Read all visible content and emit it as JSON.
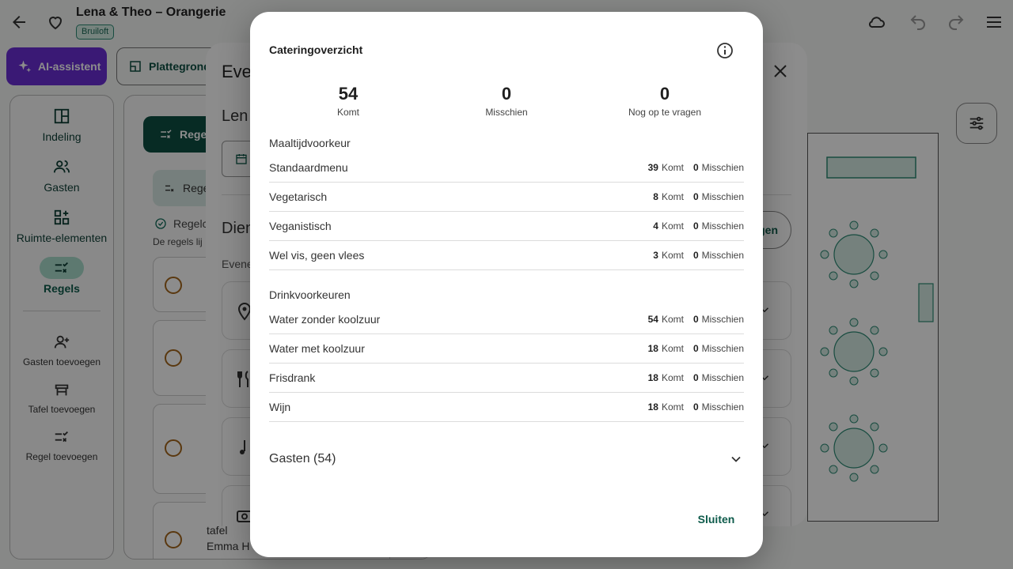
{
  "app": {
    "title": "Lena & Theo – Orangerie",
    "chip": "Bruiloft",
    "ai_button": "AI-assistent",
    "plan_button": "Plattegrond"
  },
  "nav": {
    "items": [
      {
        "label": "Indeling",
        "icon": "layout-icon"
      },
      {
        "label": "Gasten",
        "icon": "people-icon"
      },
      {
        "label": "Ruimte-elementen",
        "icon": "grid-add-icon"
      },
      {
        "label": "Regels",
        "icon": "rules-icon"
      }
    ],
    "actions": [
      {
        "label": "Gasten toevoegen",
        "icon": "person-add-icon"
      },
      {
        "label": "Tafel toevoegen",
        "icon": "table-icon"
      },
      {
        "label": "Regel toevoegen",
        "icon": "rule-add-icon"
      }
    ]
  },
  "rules_panel": {
    "button": "Regels",
    "subtab": "Regels",
    "status": "Regelc",
    "hint": "De regels lij",
    "tafel": "tafel",
    "guest_partial": "Emma H"
  },
  "event_dialog": {
    "title": "Eve",
    "subtitle": "Len",
    "section": "Dien",
    "small": "Evene",
    "pill": "gen"
  },
  "dialog": {
    "title": "Cateringoverzicht",
    "stats": [
      {
        "value": "54",
        "label": "Komt"
      },
      {
        "value": "0",
        "label": "Misschien"
      },
      {
        "value": "0",
        "label": "Nog op te vragen"
      }
    ],
    "komt_label": "Komt",
    "misschien_label": "Misschien",
    "meal_title": "Maaltijdvoorkeur",
    "meals": [
      {
        "name": "Standaardmenu",
        "komt": "39",
        "misschien": "0"
      },
      {
        "name": "Vegetarisch",
        "komt": "8",
        "misschien": "0"
      },
      {
        "name": "Veganistisch",
        "komt": "4",
        "misschien": "0"
      },
      {
        "name": "Wel vis, geen vlees",
        "komt": "3",
        "misschien": "0"
      }
    ],
    "drink_title": "Drinkvoorkeuren",
    "drinks": [
      {
        "name": "Water zonder koolzuur",
        "komt": "54",
        "misschien": "0"
      },
      {
        "name": "Water met koolzuur",
        "komt": "18",
        "misschien": "0"
      },
      {
        "name": "Frisdrank",
        "komt": "18",
        "misschien": "0"
      },
      {
        "name": "Wijn",
        "komt": "18",
        "misschien": "0"
      }
    ],
    "guests_label": "Gasten (54)",
    "close_label": "Sluiten"
  }
}
